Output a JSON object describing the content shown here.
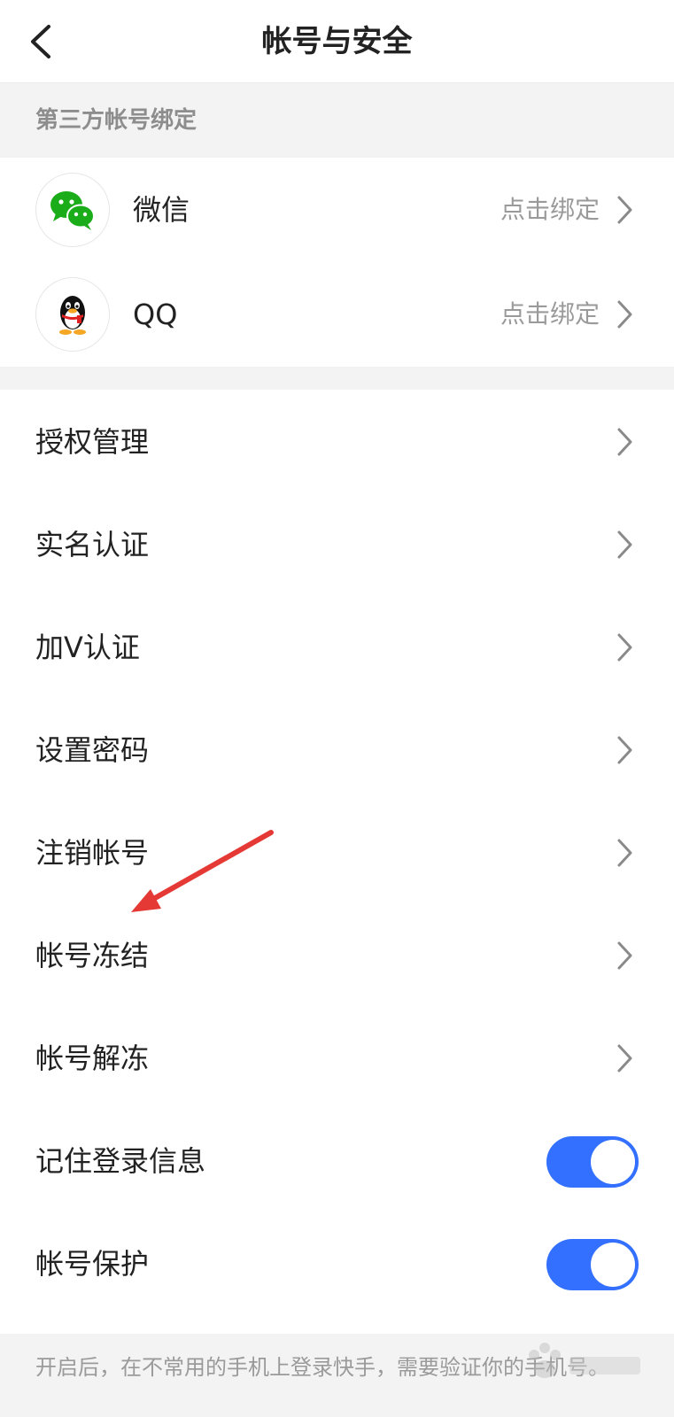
{
  "navbar": {
    "title": "帐号与安全",
    "back_icon": "chevron-left-icon"
  },
  "third_party": {
    "header": "第三方帐号绑定",
    "items": [
      {
        "label": "微信",
        "action": "点击绑定",
        "icon": "wechat-icon",
        "color": "#1aad19"
      },
      {
        "label": "QQ",
        "action": "点击绑定",
        "icon": "qq-penguin-icon"
      }
    ]
  },
  "menu": {
    "items": [
      {
        "label": "授权管理"
      },
      {
        "label": "实名认证"
      },
      {
        "label": "加V认证"
      },
      {
        "label": "设置密码"
      },
      {
        "label": "注销帐号"
      },
      {
        "label": "帐号冻结"
      },
      {
        "label": "帐号解冻"
      }
    ],
    "toggles": [
      {
        "label": "记住登录信息",
        "on": true
      },
      {
        "label": "帐号保护",
        "on": true
      }
    ]
  },
  "footer": {
    "text": "开启后，在不常用的手机上登录快手，需要验证你的手机号。"
  },
  "colors": {
    "accent": "#3370ff",
    "annotation": "#e53935",
    "section_bg": "#f3f3f3"
  }
}
